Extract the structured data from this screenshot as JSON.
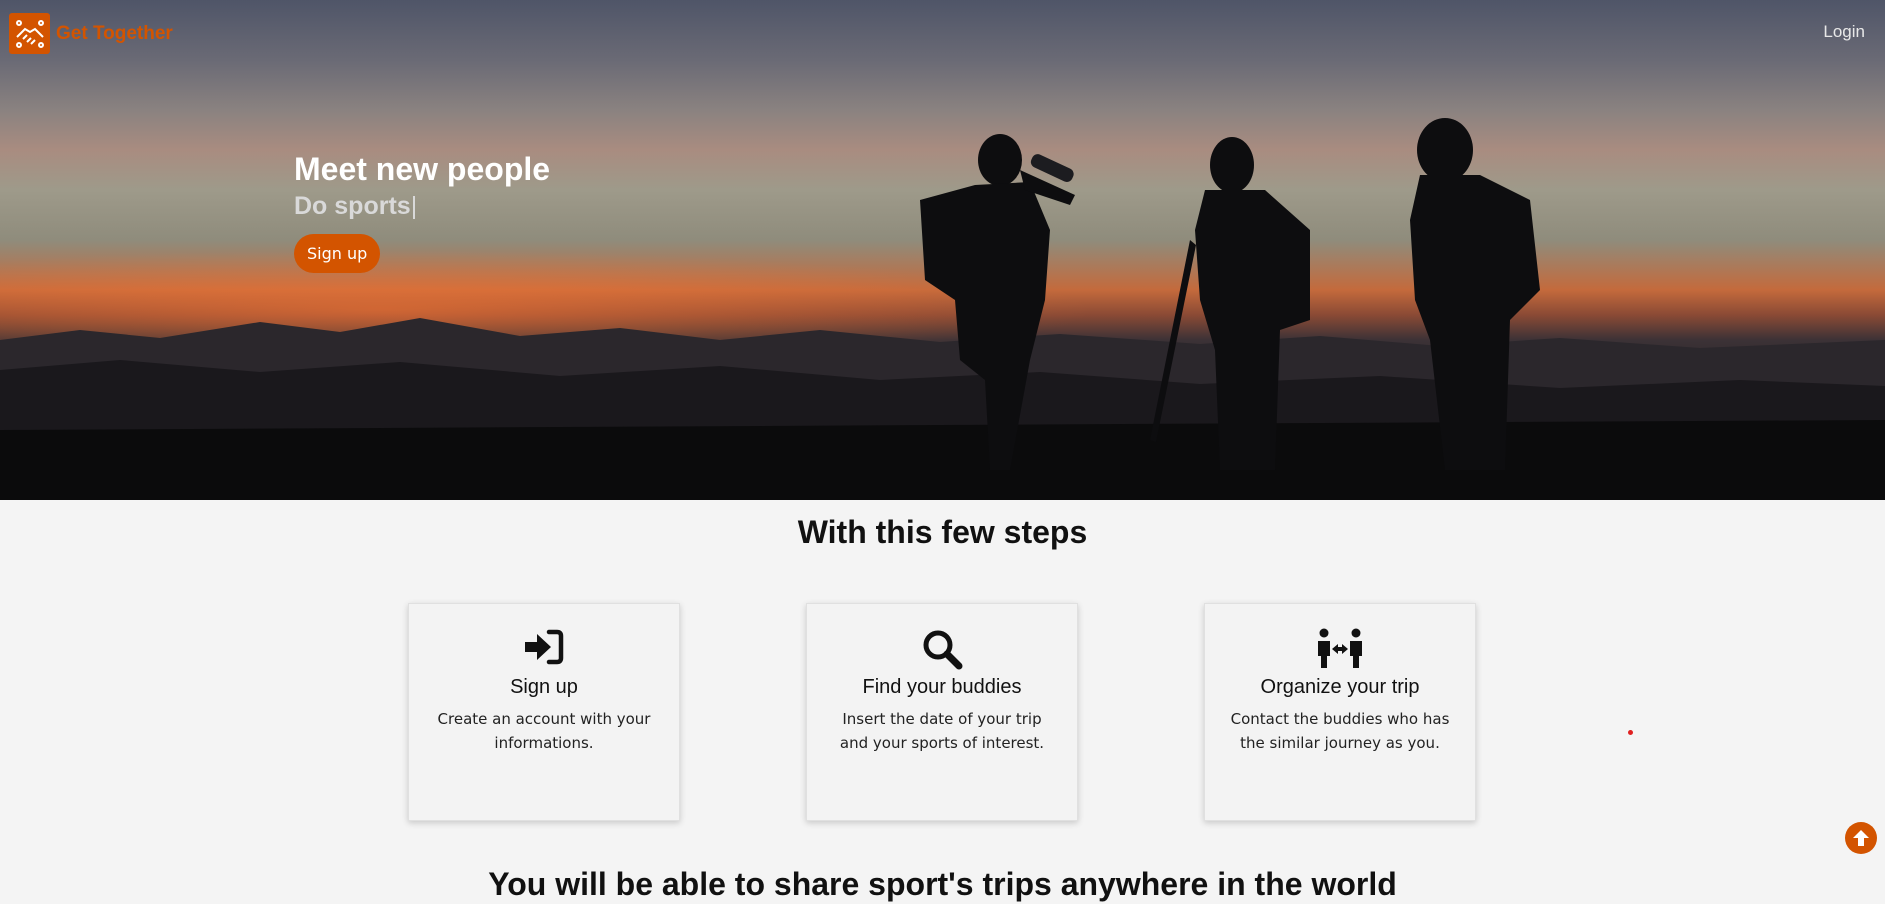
{
  "header": {
    "brand": "Get Together",
    "login_label": "Login"
  },
  "hero": {
    "title": "Meet new people",
    "subtitle": "Do sports",
    "cursor": "|",
    "signup_label": "Sign up"
  },
  "steps": {
    "title": "With this few steps",
    "cards": [
      {
        "icon": "sign-in-icon",
        "title": "Sign up",
        "text": "Create an account with your informations."
      },
      {
        "icon": "search-icon",
        "title": "Find your buddies",
        "text": "Insert the date of your trip and your sports of interest."
      },
      {
        "icon": "people-arrows-icon",
        "title": "Organize your trip",
        "text": "Contact the buddies who has the similar journey as you."
      }
    ]
  },
  "section2": {
    "title": "You will be able to share sport's trips anywhere in the world"
  },
  "colors": {
    "accent": "#d35400",
    "background": "#f4f4f4"
  }
}
